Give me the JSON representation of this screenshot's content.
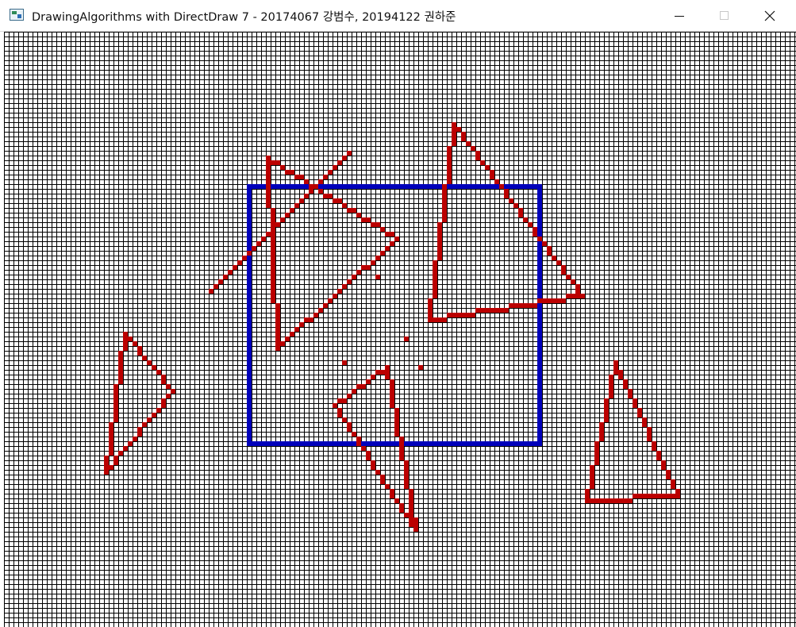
{
  "window": {
    "title": "DrawingAlgorithms with DirectDraw 7 - 20174067 강범수, 20194122 권하준",
    "icon": "app-window-icon",
    "controls": [
      "minimize",
      "maximize",
      "close"
    ]
  },
  "canvas": {
    "background": "#ffffff",
    "grid_line_color": "#000000",
    "shapes": [
      {
        "type": "rectangle",
        "color": "#0000bb",
        "label": "blue-rectangle"
      },
      {
        "type": "triangle",
        "color": "#bb0000",
        "label": "triangle-left-small"
      },
      {
        "type": "triangle",
        "color": "#bb0000",
        "label": "triangle-upper-center"
      },
      {
        "type": "line",
        "color": "#bb0000",
        "label": "diagonal-line"
      },
      {
        "type": "triangle",
        "color": "#bb0000",
        "label": "triangle-upper-right"
      },
      {
        "type": "triangle",
        "color": "#bb0000",
        "label": "triangle-lower-center"
      },
      {
        "type": "triangle",
        "color": "#bb0000",
        "label": "triangle-lower-right"
      },
      {
        "type": "dots",
        "color": "#bb0000",
        "label": "scattered-dots"
      }
    ]
  }
}
